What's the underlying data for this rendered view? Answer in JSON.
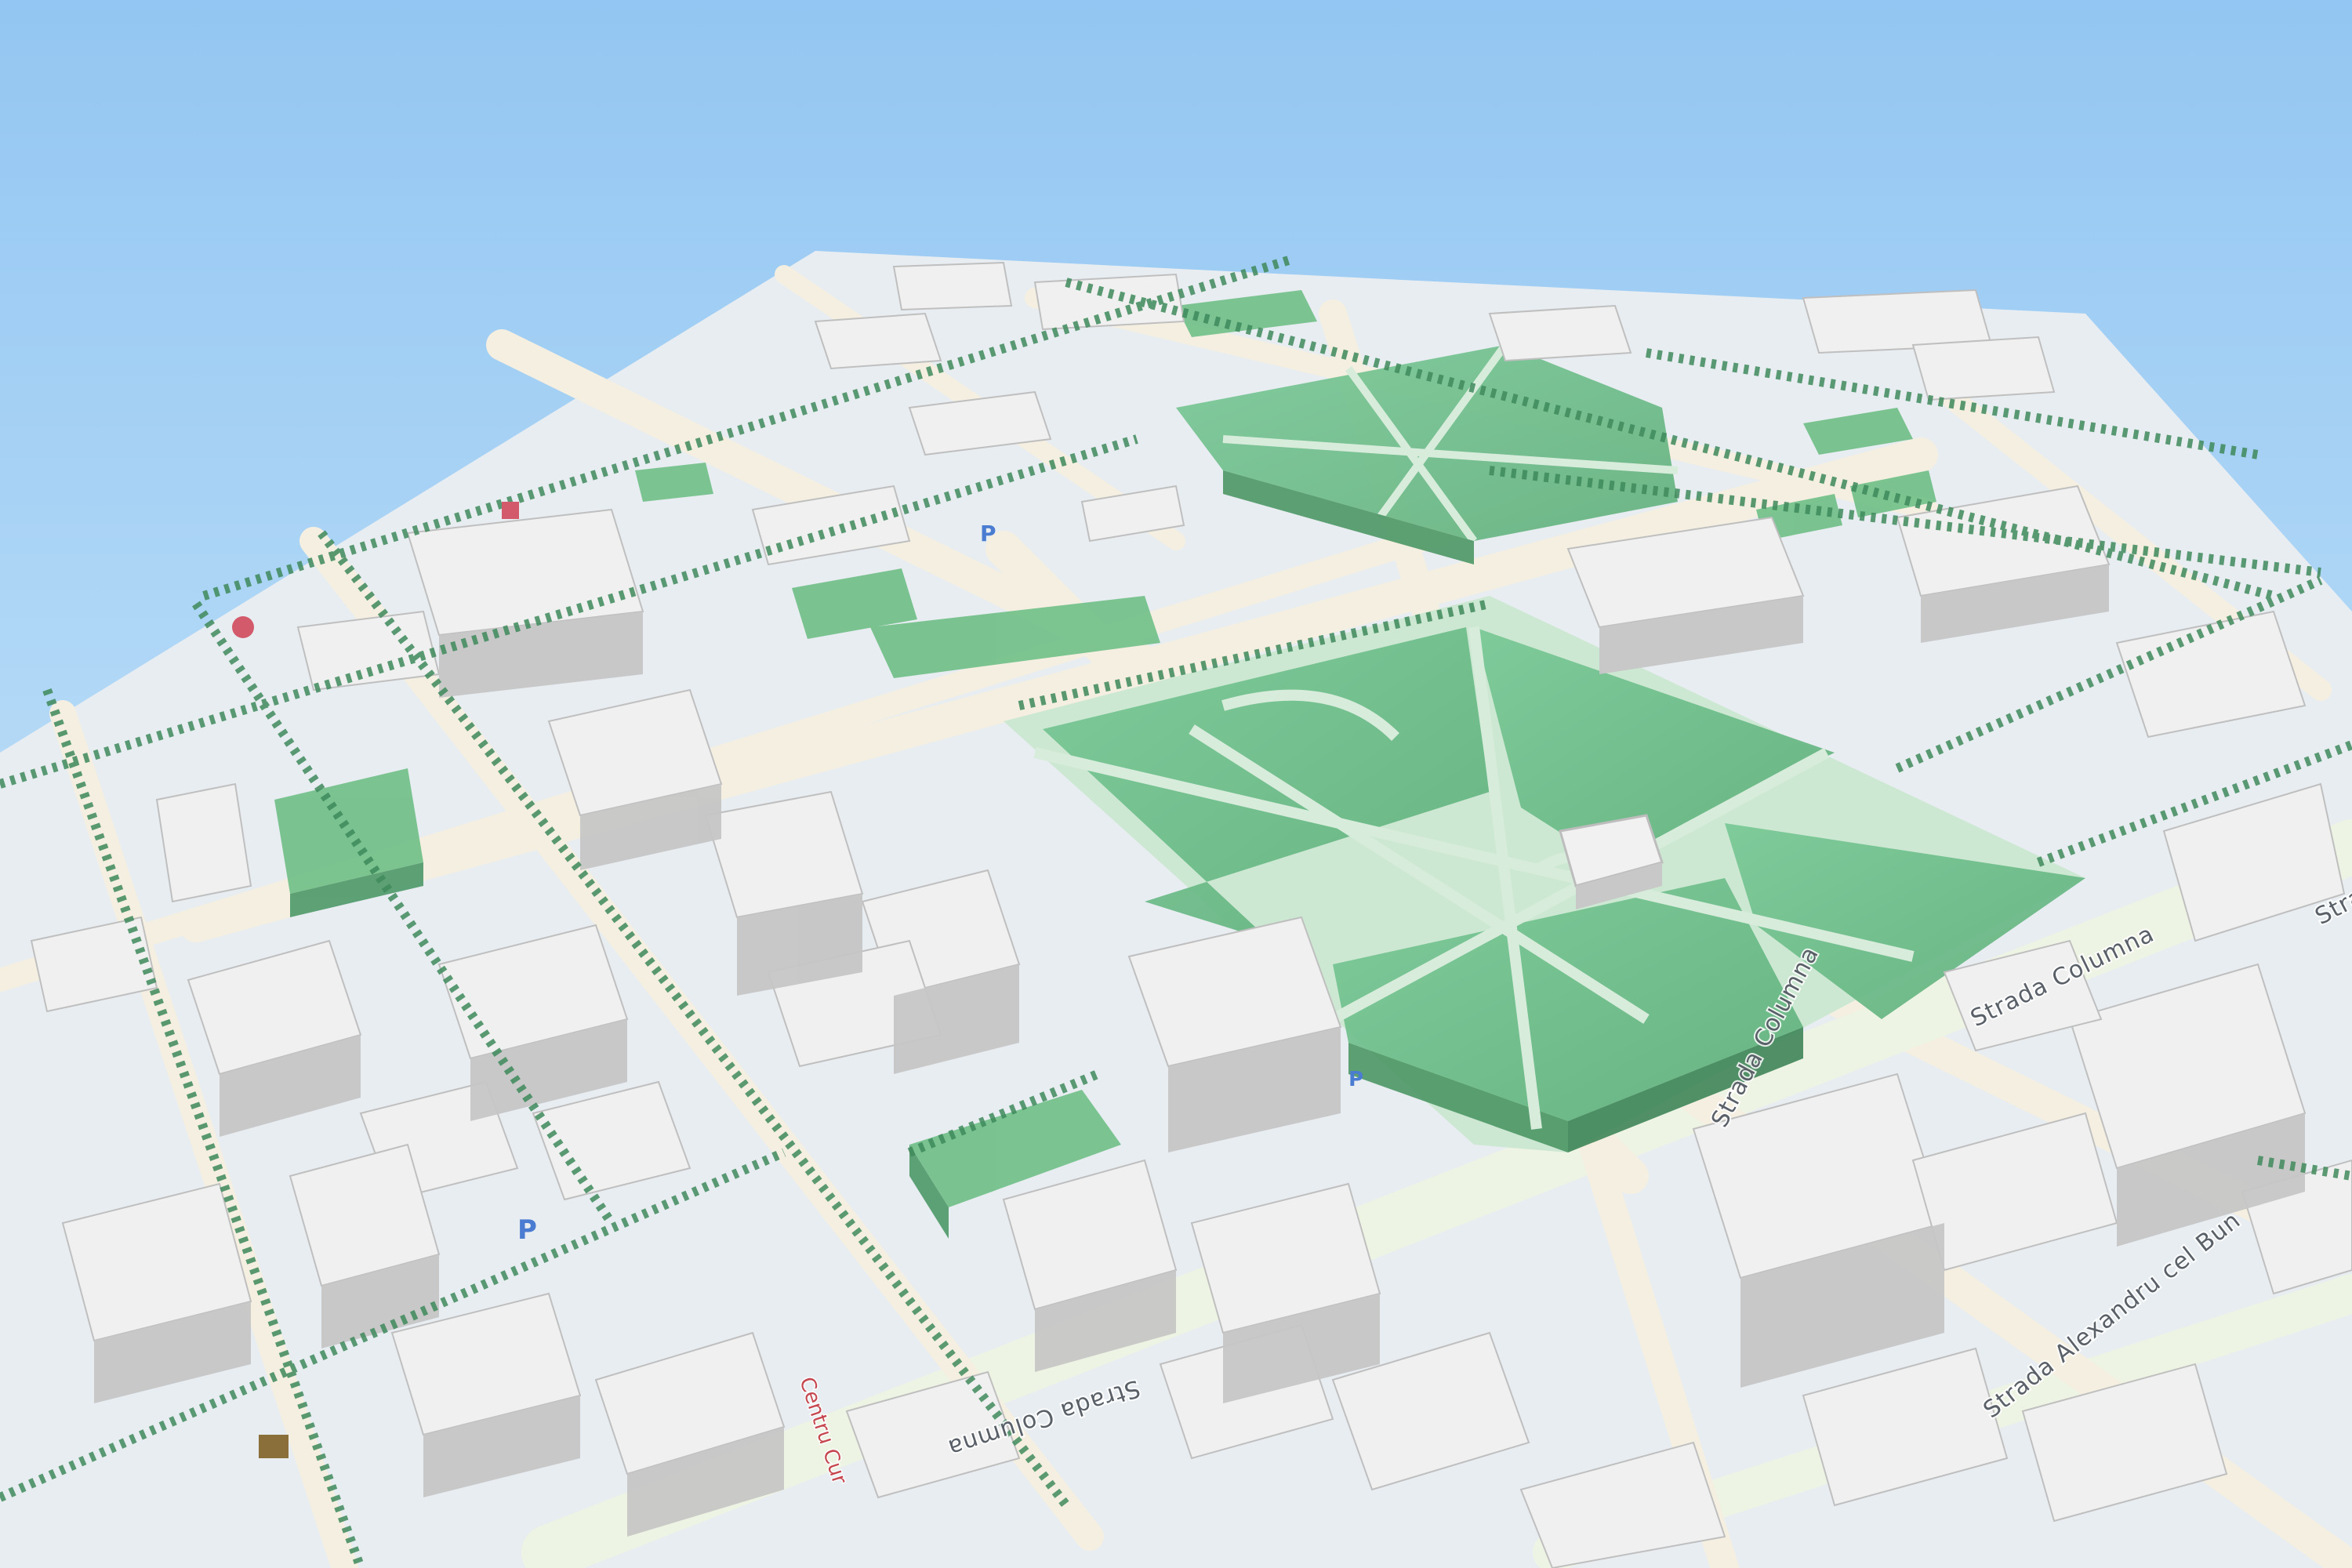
{
  "map": {
    "view": "3D perspective city map",
    "colors": {
      "sky_top": "#93c6f2",
      "sky_bottom": "#d6edfb",
      "ground": "#e9eef2",
      "road": "#f6f3ea",
      "park": "#6fc088",
      "building_top": "#efefef",
      "building_side": "#c9c9c9",
      "tree": "#3f8a5c",
      "street_text": "#5a6068",
      "poi": "#c5464e"
    },
    "street_labels": [
      {
        "id": "strada-columna-east",
        "text": "Strada Columna"
      },
      {
        "id": "strada-columna-mid",
        "text": "Strada Columna"
      },
      {
        "id": "strada-columna-south",
        "text": "Strada Columna"
      },
      {
        "id": "strada-alexandru",
        "text": "Strada Alexandru cel Bun"
      },
      {
        "id": "strada-columna-far",
        "text": "Strada Columna"
      }
    ],
    "poi_labels": [
      {
        "id": "poi-centru",
        "text": "Centru Cur"
      }
    ],
    "icons": [
      "parking-icon",
      "parking-icon",
      "parking-icon",
      "atm-icon",
      "shop-icon",
      "hospital-icon"
    ]
  }
}
